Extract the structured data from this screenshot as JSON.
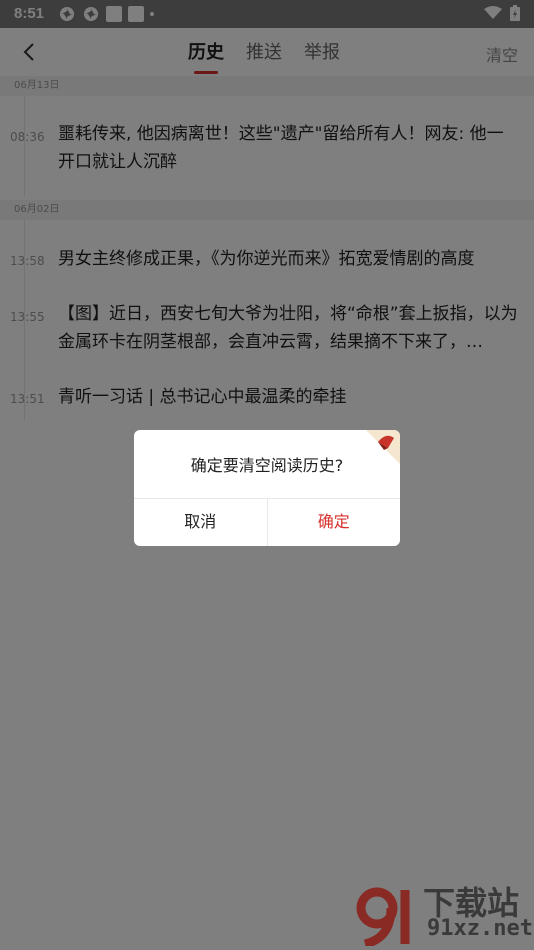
{
  "status_bar": {
    "time": "8:51"
  },
  "header": {
    "tabs": [
      {
        "label": "历史",
        "active": true
      },
      {
        "label": "推送",
        "active": false
      },
      {
        "label": "举报",
        "active": false
      }
    ],
    "clear_label": "清空"
  },
  "groups": [
    {
      "date": "06月13日",
      "entries": [
        {
          "time": "08:36",
          "title": "噩耗传来, 他因病离世！这些\"遗产\"留给所有人！网友: 他一开口就让人沉醉"
        }
      ]
    },
    {
      "date": "06月02日",
      "entries": [
        {
          "time": "13:58",
          "title": "男女主终修成正果，《为你逆光而来》拓宽爱情剧的高度"
        },
        {
          "time": "13:55",
          "title": "【图】近日，西安七旬大爷为壮阳，将“命根”套上扳指，以为金属环卡在阴茎根部，会直冲云霄，结果摘不下来了，…"
        },
        {
          "time": "13:51",
          "title": "青听一习话 | 总书记心中最温柔的牵挂"
        }
      ]
    }
  ],
  "dialog": {
    "message": "确定要清空阅读历史?",
    "cancel_label": "取消",
    "confirm_label": "确定"
  },
  "watermark": {
    "line1": "下载站",
    "line2": "91xz.net"
  },
  "colors": {
    "accent": "#d8302d"
  }
}
